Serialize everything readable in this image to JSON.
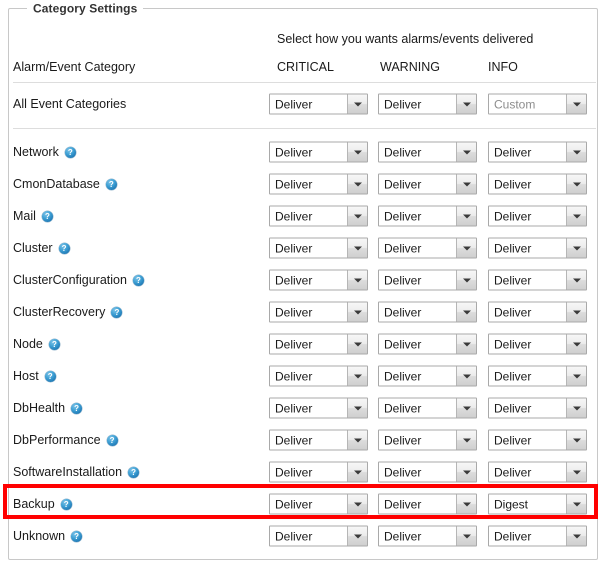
{
  "panel": {
    "legend": "Category Settings"
  },
  "header": {
    "note": "Select how you wants alarms/events delivered",
    "category_column": "Alarm/Event Category",
    "columns": [
      "CRITICAL",
      "WARNING",
      "INFO"
    ]
  },
  "icons": {
    "help": "help-icon",
    "dropdown_arrow": "chevron-down-icon"
  },
  "colors": {
    "highlight": "#ff0000",
    "help_icon": "#1f78b4",
    "border": "#c8c8c8",
    "rule": "#dddddd",
    "muted_text": "#8d8d8d"
  },
  "rows": [
    {
      "label": "All Event Categories",
      "has_help": false,
      "critical": "Deliver",
      "warning": "Deliver",
      "info": "Custom",
      "info_muted": true,
      "highlighted": false
    },
    {
      "label": "Network",
      "has_help": true,
      "critical": "Deliver",
      "warning": "Deliver",
      "info": "Deliver",
      "info_muted": false,
      "highlighted": false
    },
    {
      "label": "CmonDatabase",
      "has_help": true,
      "critical": "Deliver",
      "warning": "Deliver",
      "info": "Deliver",
      "info_muted": false,
      "highlighted": false
    },
    {
      "label": "Mail",
      "has_help": true,
      "critical": "Deliver",
      "warning": "Deliver",
      "info": "Deliver",
      "info_muted": false,
      "highlighted": false
    },
    {
      "label": "Cluster",
      "has_help": true,
      "critical": "Deliver",
      "warning": "Deliver",
      "info": "Deliver",
      "info_muted": false,
      "highlighted": false
    },
    {
      "label": "ClusterConfiguration",
      "has_help": true,
      "critical": "Deliver",
      "warning": "Deliver",
      "info": "Deliver",
      "info_muted": false,
      "highlighted": false
    },
    {
      "label": "ClusterRecovery",
      "has_help": true,
      "critical": "Deliver",
      "warning": "Deliver",
      "info": "Deliver",
      "info_muted": false,
      "highlighted": false
    },
    {
      "label": "Node",
      "has_help": true,
      "critical": "Deliver",
      "warning": "Deliver",
      "info": "Deliver",
      "info_muted": false,
      "highlighted": false
    },
    {
      "label": "Host",
      "has_help": true,
      "critical": "Deliver",
      "warning": "Deliver",
      "info": "Deliver",
      "info_muted": false,
      "highlighted": false
    },
    {
      "label": "DbHealth",
      "has_help": true,
      "critical": "Deliver",
      "warning": "Deliver",
      "info": "Deliver",
      "info_muted": false,
      "highlighted": false
    },
    {
      "label": "DbPerformance",
      "has_help": true,
      "critical": "Deliver",
      "warning": "Deliver",
      "info": "Deliver",
      "info_muted": false,
      "highlighted": false
    },
    {
      "label": "SoftwareInstallation",
      "has_help": true,
      "critical": "Deliver",
      "warning": "Deliver",
      "info": "Deliver",
      "info_muted": false,
      "highlighted": false
    },
    {
      "label": "Backup",
      "has_help": true,
      "critical": "Deliver",
      "warning": "Deliver",
      "info": "Digest",
      "info_muted": false,
      "highlighted": true
    },
    {
      "label": "Unknown",
      "has_help": true,
      "critical": "Deliver",
      "warning": "Deliver",
      "info": "Deliver",
      "info_muted": false,
      "highlighted": false
    }
  ]
}
